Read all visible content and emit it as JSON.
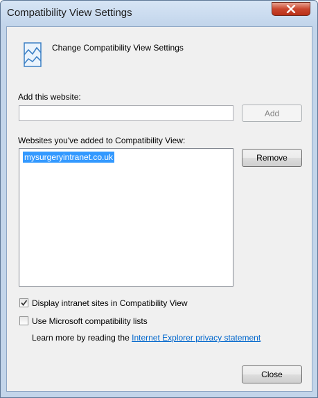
{
  "window": {
    "title": "Compatibility View Settings",
    "close_glyph": "✕"
  },
  "header": {
    "icon": "compatibility-view-icon",
    "text": "Change Compatibility View Settings"
  },
  "add_site": {
    "label": "Add this website:",
    "value": "",
    "add_button": "Add"
  },
  "sites": {
    "label": "Websites you've added to Compatibility View:",
    "items": [
      "mysurgeryintranet.co.uk"
    ],
    "remove_button": "Remove"
  },
  "options": {
    "intranet_label": "Display intranet sites in Compatibility View",
    "intranet_checked": true,
    "ms_lists_label": "Use Microsoft compatibility lists",
    "ms_lists_checked": false
  },
  "learn_more": {
    "prefix": "Learn more by reading the",
    "link": "Internet Explorer privacy statement"
  },
  "footer": {
    "close_button": "Close"
  },
  "colors": {
    "accent": "#3399ff",
    "link": "#0066cc",
    "close_red": "#c9462e"
  }
}
